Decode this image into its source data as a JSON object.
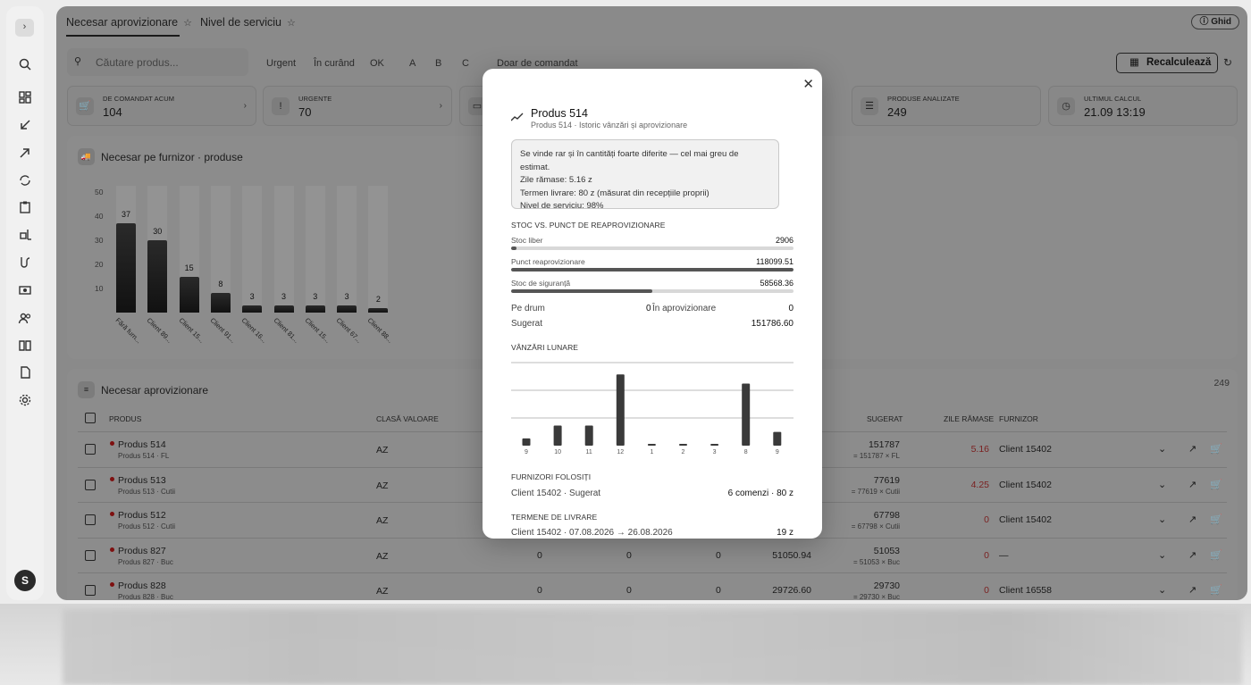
{
  "tabs": [
    {
      "label": "Necesar aprovizionare",
      "active": true
    },
    {
      "label": "Nivel de serviciu",
      "active": false
    }
  ],
  "help_label": "Ghid",
  "user_initial": "S",
  "search_placeholder": "Căutare produs...",
  "filters": [
    "Urgent",
    "În curând",
    "OK",
    "A",
    "B",
    "C",
    "Doar de comandat"
  ],
  "recalc_label": "Recalculează",
  "kpis": [
    {
      "label": "DE COMANDAT ACUM",
      "value": "104"
    },
    {
      "label": "URGENTE",
      "value": "70"
    },
    {
      "label": "PRODUSE ANALIZATE",
      "value": "249"
    },
    {
      "label": "ULTIMUL CALCUL",
      "value": "21.09 13:19"
    }
  ],
  "supplier_panel_title": "Necesar pe furnizor · produse",
  "chart_data": {
    "type": "bar",
    "title": "Necesar pe furnizor · produse",
    "categories": [
      "Fără furn...",
      "Client 89...",
      "Client 15...",
      "Client 91...",
      "Client 16...",
      "Client 81...",
      "Client 15...",
      "Client 67...",
      "Client 88..."
    ],
    "values": [
      37,
      30,
      15,
      8,
      3,
      3,
      3,
      3,
      2
    ],
    "y_ticks": [
      10,
      20,
      30,
      40,
      50
    ],
    "ylim": [
      0,
      50
    ],
    "grid": false
  },
  "table_panel_title": "Necesar aprovizionare",
  "table_count": "249",
  "table_headers": {
    "product": "PRODUS",
    "class": "CLASĂ VALOARE",
    "suggested": "SUGERAT",
    "days_left": "ZILE RĂMASE",
    "supplier": "FURNIZOR"
  },
  "rows": [
    {
      "name": "Produs 514",
      "sub": "Produs 514 · FL",
      "class": "AZ",
      "c1": "",
      "c2": "",
      "c3": "",
      "c4": "",
      "sug": "151787",
      "sug_sub": "= 151787 × FL",
      "days": "5.16",
      "supplier": "Client 15402"
    },
    {
      "name": "Produs 513",
      "sub": "Produs 513 · Cutii",
      "class": "AZ",
      "c1": "",
      "c2": "",
      "c3": "",
      "c4": "",
      "sug": "77619",
      "sug_sub": "= 77619 × Cutii",
      "days": "4.25",
      "supplier": "Client 15402"
    },
    {
      "name": "Produs 512",
      "sub": "Produs 512 · Cutii",
      "class": "AZ",
      "c1": "",
      "c2": "",
      "c3": "",
      "c4": "",
      "sug": "67798",
      "sug_sub": "= 67798 × Cutii",
      "days": "0",
      "supplier": "Client 15402"
    },
    {
      "name": "Produs 827",
      "sub": "Produs 827 · Buc",
      "class": "AZ",
      "c1": "0",
      "c2": "0",
      "c3": "0",
      "c4": "51050.94",
      "sug": "51053",
      "sug_sub": "= 51053 × Buc",
      "days": "0",
      "supplier": "—"
    },
    {
      "name": "Produs 828",
      "sub": "Produs 828 · Buc",
      "class": "AZ",
      "c1": "0",
      "c2": "0",
      "c3": "0",
      "c4": "29726.60",
      "sug": "29730",
      "sug_sub": "= 29730 × Buc",
      "days": "0",
      "supplier": "Client 16558"
    }
  ],
  "modal": {
    "title": "Produs 514",
    "subtitle": "Produs 514 · Istoric vânzări și aprovizionare",
    "note_lines": [
      "Se vinde rar și în cantități foarte diferite — cel mai greu de estimat.",
      "Zile rămase: 5.16 z",
      "Termen livrare: 80 z (măsurat din recepțiile proprii)",
      "Nivel de serviciu: 98%"
    ],
    "stock_section": "STOC VS. PUNCT DE REAPROVIZIONARE",
    "stock_bars": [
      {
        "label": "Stoc liber",
        "value": "2906",
        "fill": 0.02
      },
      {
        "label": "Punct reaprovizionare",
        "value": "118099.51",
        "fill": 1.0
      },
      {
        "label": "Stoc de siguranță",
        "value": "58568.36",
        "fill": 0.5
      }
    ],
    "on_road_label": "Pe drum",
    "on_road_value": "0",
    "in_supply_label": "În aprovizionare",
    "in_supply_value": "0",
    "suggested_label": "Sugerat",
    "suggested_value": "151786.60",
    "sales_section": "VÂNZĂRI LUNARE",
    "sales_chart": {
      "type": "bar",
      "categories": [
        "9",
        "10",
        "11",
        "12",
        "1",
        "2",
        "3",
        "8",
        "9"
      ],
      "values": [
        8,
        22,
        22,
        78,
        2,
        2,
        2,
        68,
        15
      ],
      "ylim": [
        0,
        90
      ],
      "grid": true
    },
    "suppliers_section": "FURNIZORI FOLOSIȚI",
    "supplier_line": "Client 15402 · Sugerat",
    "supplier_value": "6 comenzi · 80 z",
    "terms_section": "TERMENE DE LIVRARE",
    "term_line": "Client 15402 · 07.08.2026 → 26.08.2026",
    "term_value": "19 z"
  }
}
